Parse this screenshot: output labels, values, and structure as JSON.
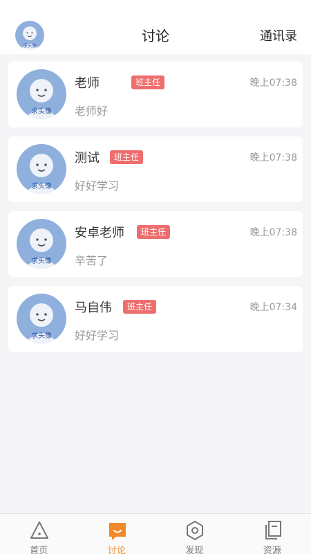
{
  "header": {
    "title": "讨论",
    "contacts_label": "通讯录",
    "avatar_text": "求头像"
  },
  "conversations": [
    {
      "name": "老师",
      "badge": "班主任",
      "time": "晚上07:38",
      "message": "老师好",
      "avatar_text": "求头像"
    },
    {
      "name": "测试",
      "badge": "班主任",
      "time": "晚上07:38",
      "message": "好好学习",
      "avatar_text": "求头像"
    },
    {
      "name": "安卓老师",
      "badge": "班主任",
      "time": "晚上07:38",
      "message": "辛苦了",
      "avatar_text": "求头像"
    },
    {
      "name": "马自伟",
      "badge": "班主任",
      "time": "晚上07:34",
      "message": "好好学习",
      "avatar_text": "求头像"
    }
  ],
  "tabbar": {
    "tabs": [
      {
        "label": "首页",
        "icon": "home-triangle-icon",
        "active": false
      },
      {
        "label": "讨论",
        "icon": "chat-bubble-icon",
        "active": true
      },
      {
        "label": "发现",
        "icon": "hexagon-discover-icon",
        "active": false
      },
      {
        "label": "资源",
        "icon": "resource-files-icon",
        "active": false
      }
    ]
  },
  "colors": {
    "accent": "#f0892b",
    "badge": "#ee6e6e",
    "avatar_bg": "#8fb0dc",
    "background": "#f5f5f7"
  }
}
